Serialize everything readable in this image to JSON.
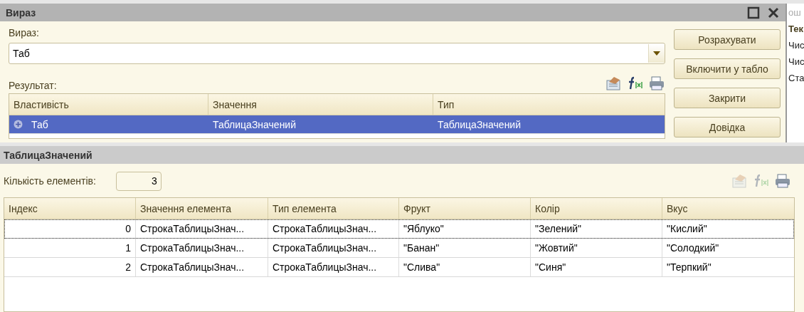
{
  "background_window": {
    "texts": [
      {
        "text": "ош",
        "bold": false
      },
      {
        "text": "Тек",
        "bold": true
      },
      {
        "text": "Чис",
        "bold": false
      },
      {
        "text": "Чис",
        "bold": false
      },
      {
        "text": "Ста",
        "bold": false
      }
    ]
  },
  "dialog": {
    "title": "Вираз",
    "expression_label": "Вираз:",
    "expression_value": "Таб",
    "result_label": "Результат:",
    "toolbar": [
      {
        "kind": "report",
        "disabled": false
      },
      {
        "kind": "formula",
        "disabled": false
      },
      {
        "kind": "print",
        "disabled": false
      }
    ],
    "columns": [
      "Властивість",
      "Значення",
      "Тип"
    ],
    "rows": [
      {
        "cells": [
          "Таб",
          "ТаблицаЗначений",
          "ТаблицаЗначений"
        ],
        "expandable": true,
        "selected": true
      }
    ],
    "buttons": [
      "Розрахувати",
      "Включити у табло",
      "Закрити",
      "Довідка"
    ]
  },
  "panel": {
    "title": "ТаблицаЗначений",
    "count_label": "Кількість елементів:",
    "count_value": "3",
    "toolbar": [
      {
        "kind": "report",
        "disabled": true
      },
      {
        "kind": "formula",
        "disabled": true
      },
      {
        "kind": "print",
        "disabled": false
      }
    ],
    "columns": [
      "Індекс",
      "Значення елемента",
      "Тип елемента",
      "Фрукт",
      "Колір",
      "Вкус"
    ],
    "rows": [
      {
        "cells": [
          "0",
          "СтрокаТаблицыЗнач...",
          "СтрокаТаблицыЗнач...",
          "\"Яблуко\"",
          "\"Зелений\"",
          "\"Кислий\""
        ],
        "selected": true
      },
      {
        "cells": [
          "1",
          "СтрокаТаблицыЗнач...",
          "СтрокаТаблицыЗнач...",
          "\"Банан\"",
          "\"Жовтий\"",
          "\"Солодкий\""
        ],
        "selected": false
      },
      {
        "cells": [
          "2",
          "СтрокаТаблицыЗнач...",
          "СтрокаТаблицыЗнач...",
          "\"Слива\"",
          "\"Синя\"",
          "\"Терпкий\""
        ],
        "selected": false
      }
    ]
  }
}
